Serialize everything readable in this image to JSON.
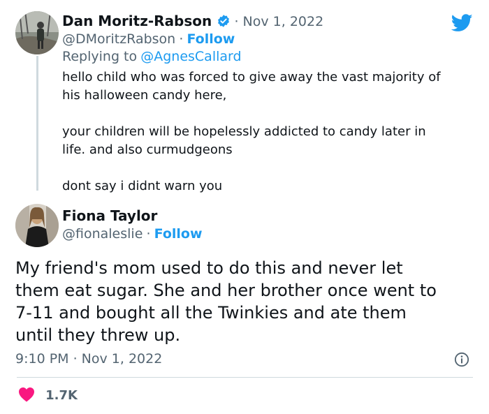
{
  "reply_tweet": {
    "author_name": "Dan Moritz-Rabson",
    "sep_date": "· Nov 1, 2022",
    "handle": "@DMoritzRabson",
    "handle_sep": "·",
    "follow_label": "Follow",
    "replying_prefix": "Replying to",
    "replying_handle": "@AgnesCallard",
    "text_lines": [
      "hello child who was forced to give away the vast majority of",
      "his halloween candy here,",
      "your children will be hopelessly addicted to candy later in",
      "life. and also curmudgeons",
      "dont say i didnt warn you"
    ]
  },
  "main_tweet": {
    "author_name": "Fiona Taylor",
    "handle": "@fionaleslie",
    "handle_sep": "·",
    "follow_label": "Follow",
    "text_lines": [
      "My friend's mom used to do this and never let",
      "them eat sugar. She and her brother once went to",
      "7-11 and bought all the Twinkies and ate them",
      "until they threw up."
    ],
    "timestamp": "9:10 PM · Nov 1, 2022",
    "likes": "1.7K"
  },
  "colors": {
    "twitter_blue": "#1d9bf0",
    "like_red": "#f91880",
    "muted": "#536471"
  },
  "icons": [
    "verified-badge-icon",
    "twitter-bird-icon",
    "info-icon",
    "heart-icon"
  ]
}
